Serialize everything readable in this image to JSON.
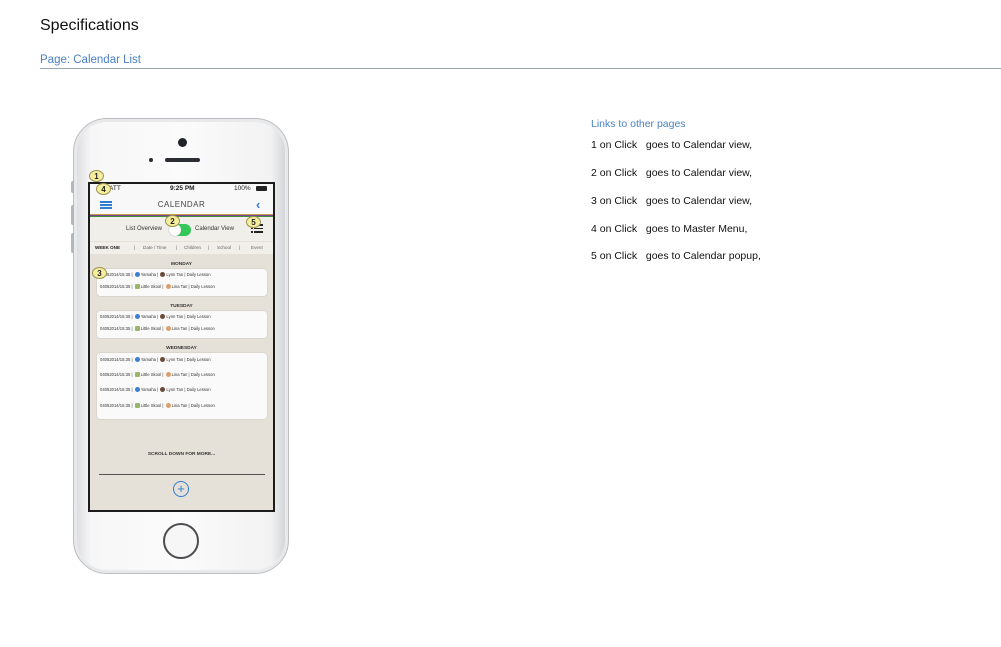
{
  "doc": {
    "title": "Specifications",
    "page_label": "Page: Calendar List"
  },
  "phone": {
    "status": {
      "carrier": "ATT",
      "time": "9:25 PM",
      "battery": "100%"
    },
    "nav": {
      "title": "CALENDAR",
      "back_glyph": "‹"
    },
    "toggle": {
      "left_label": "List Overview",
      "right_label": "Calendar View"
    },
    "filters": [
      "WEEK ONE",
      "|",
      "Date / Time",
      "|",
      "Children",
      "|",
      "School",
      "|",
      "Event"
    ],
    "days": [
      {
        "name": "MONDAY",
        "rows": [
          {
            "date": "04052014/15:35",
            "school": "Yamaha",
            "child": "Lynn Tan",
            "event": "Daily Lesson"
          },
          {
            "date": "04052014/15:35",
            "school": "Little Skool",
            "child": "Lina Tan",
            "event": "Daily Lesson"
          }
        ]
      },
      {
        "name": "TUESDAY",
        "rows": [
          {
            "date": "04052014/15:35",
            "school": "Yamaha",
            "child": "Lynn Tan",
            "event": "Daily Lesson"
          },
          {
            "date": "04052014/15:35",
            "school": "Little Skool",
            "child": "Lina Tan",
            "event": "Daily Lesson"
          }
        ]
      },
      {
        "name": "WEDNESDAY",
        "rows": [
          {
            "date": "04052014/15:35",
            "school": "Yamaha",
            "child": "Lynn Tan",
            "event": "Daily Lesson"
          },
          {
            "date": "04052014/15:35",
            "school": "Little Skool",
            "child": "Lina Tan",
            "event": "Daily Lesson"
          },
          {
            "date": "04052014/15:35",
            "school": "Yamaha",
            "child": "Lynn Tan",
            "event": "Daily Lesson"
          },
          {
            "date": "04052014/15:35",
            "school": "Little Skool",
            "child": "Lina Tan",
            "event": "Daily Lesson"
          }
        ]
      }
    ],
    "scroll_more": "SCROLL DOWN FOR MORE...",
    "add_glyph": "+",
    "callouts": [
      "1",
      "4",
      "2",
      "5",
      "3"
    ]
  },
  "links": {
    "title": "Links to other pages",
    "items": [
      "1 on Click   goes to Calendar view,",
      "2 on Click   goes to Calendar view,",
      "3 on Click   goes to Calendar view,",
      "4 on Click   goes to Master Menu,",
      "5 on Click   goes to Calendar popup,"
    ]
  },
  "colors": {
    "accent_blue": "#2f7cd3",
    "link_blue": "#4a7fc1",
    "toggle_green": "#34c759",
    "callout_yellow": "#f5ee9e"
  }
}
